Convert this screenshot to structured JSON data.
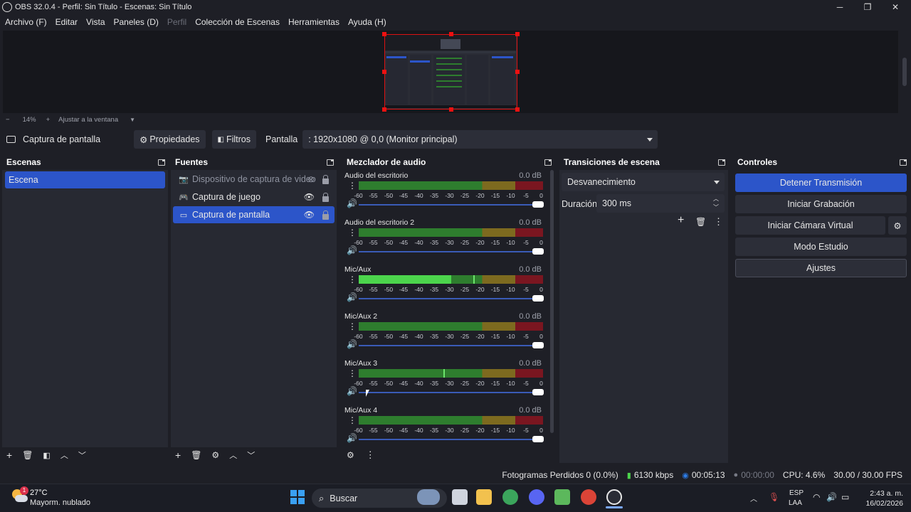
{
  "window": {
    "title": "OBS 32.0.4 - Perfil: Sin Título - Escenas: Sin Título",
    "minimize": "─",
    "maximize": "❐",
    "close": "✕"
  },
  "menu": {
    "items": [
      "Archivo (F)",
      "Editar",
      "Vista",
      "Paneles (D)",
      "Perfil",
      "Colección de Escenas",
      "Herramientas",
      "Ayuda (H)"
    ]
  },
  "zoom": {
    "minus": "−",
    "level": "14%",
    "plus": "+",
    "fit": "Ajustar a la ventana"
  },
  "source_toolbar": {
    "source_name": "Captura de pantalla",
    "properties_label": "Propiedades",
    "filters_label": "Filtros",
    "display_label": "Pantalla",
    "display_value": ": 1920x1080 @ 0,0 (Monitor principal)"
  },
  "scenes": {
    "title": "Escenas",
    "items": [
      "Escena"
    ]
  },
  "sources": {
    "title": "Fuentes",
    "items": [
      {
        "label": "Dispositivo de captura de video",
        "icon": "camera-icon",
        "visible": false
      },
      {
        "label": "Captura de juego",
        "icon": "gamepad-icon",
        "visible": true
      },
      {
        "label": "Captura de pantalla",
        "icon": "monitor-icon",
        "visible": true
      }
    ]
  },
  "mixer": {
    "title": "Mezclador de audio",
    "ticks": [
      "-60",
      "-55",
      "-50",
      "-45",
      "-40",
      "-35",
      "-30",
      "-25",
      "-20",
      "-15",
      "-10",
      "-5",
      "0"
    ],
    "channels": [
      {
        "name": "Audio del escritorio",
        "db": "0.0 dB",
        "level": 0,
        "peak": null
      },
      {
        "name": "Audio del escritorio 2",
        "db": "0.0 dB",
        "level": 0,
        "peak": null
      },
      {
        "name": "Mic/Aux",
        "db": "0.0 dB",
        "level": 0.5,
        "peak": 0.62
      },
      {
        "name": "Mic/Aux 2",
        "db": "0.0 dB",
        "level": 0,
        "peak": null
      },
      {
        "name": "Mic/Aux 3",
        "db": "0.0 dB",
        "level": 0,
        "peak": 0.46
      },
      {
        "name": "Mic/Aux 4",
        "db": "0.0 dB",
        "level": 0,
        "peak": null
      }
    ]
  },
  "transitions": {
    "title": "Transiciones de escena",
    "selected": "Desvanecimiento",
    "duration_label": "Duración",
    "duration_value": "300 ms"
  },
  "controls": {
    "title": "Controles",
    "stop_stream": "Detener Transmisión",
    "start_recording": "Iniciar Grabación",
    "start_virtual_cam": "Iniciar Cámara Virtual",
    "studio_mode": "Modo Estudio",
    "settings": "Ajustes"
  },
  "status": {
    "dropped_frames": "Fotogramas Perdidos 0 (0.0%)",
    "bitrate": "6130 kbps",
    "stream_time": "00:05:13",
    "record_time": "00:00:00",
    "cpu": "CPU: 4.6%",
    "fps": "30.00 / 30.00 FPS"
  },
  "taskbar": {
    "weather_temp": "27°C",
    "weather_desc": "Mayorm. nublado",
    "weather_badge": "1",
    "search": "Buscar",
    "lang_top": "ESP",
    "lang_bottom": "LAA",
    "time": "2:43 a. m.",
    "date": "16/02/2026"
  },
  "colors": {
    "accent": "#2c55c9",
    "background": "#1e1f26",
    "panel": "#272932",
    "selection_border": "#d11111"
  }
}
